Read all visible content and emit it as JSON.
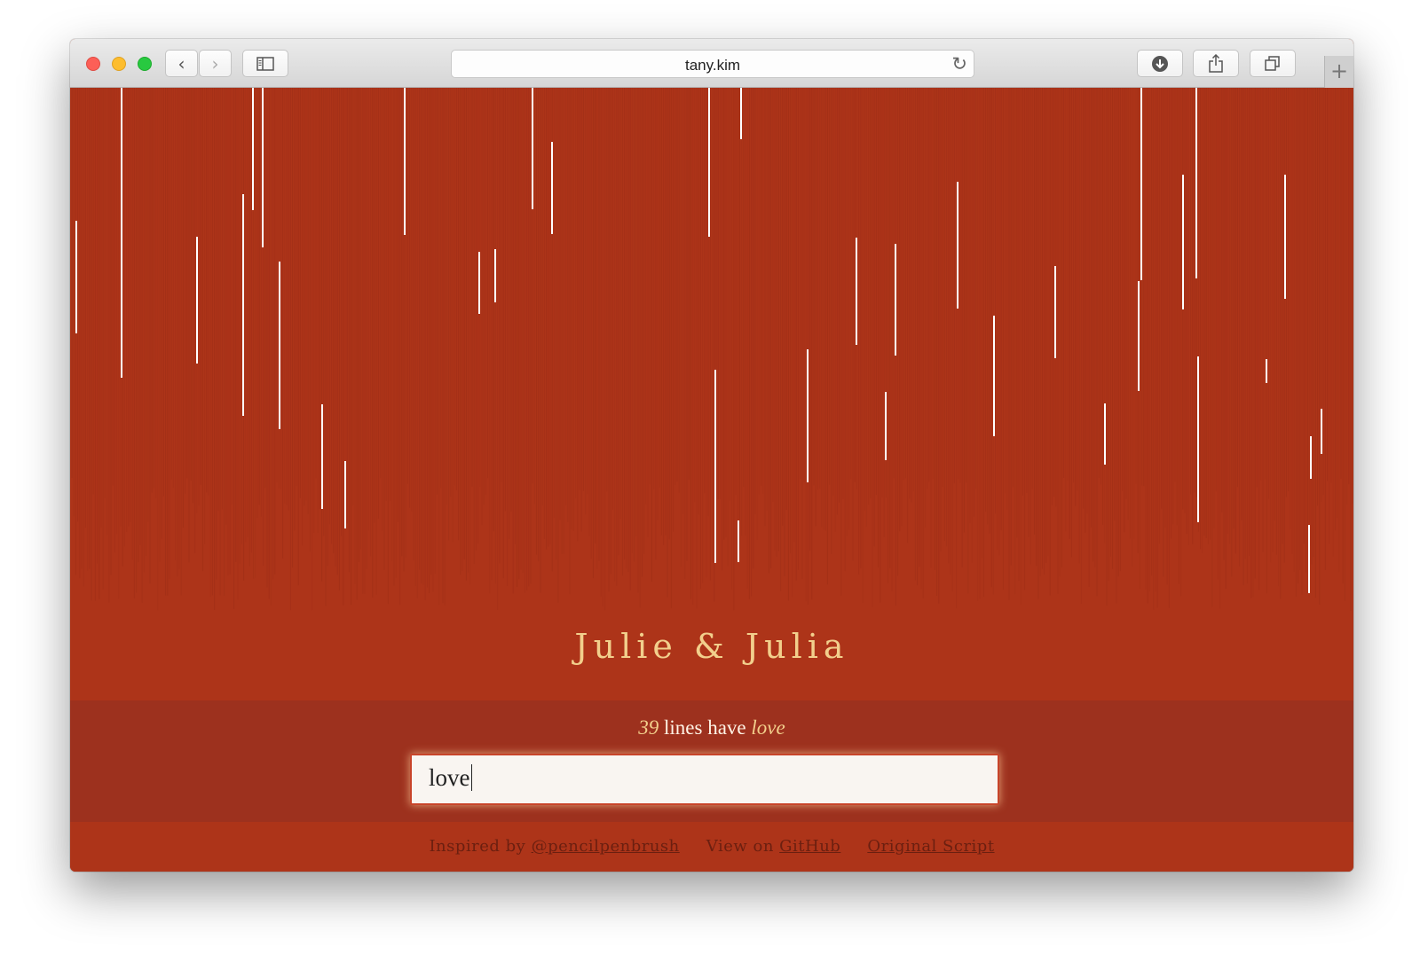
{
  "browser": {
    "url": "tany.kim",
    "back_glyph": "‹",
    "forward_glyph": "›",
    "reload_glyph": "↻",
    "new_tab_glyph": "+"
  },
  "page": {
    "title": "Julie & Julia",
    "result_count": "39",
    "result_middle": " lines have ",
    "result_term": "love",
    "search_value": "love"
  },
  "footer": {
    "inspired_prefix": "Inspired by ",
    "inspired_link": "@pencilpenbrush",
    "github_prefix": "View on ",
    "github_link": "GitHub",
    "script_link": "Original Script"
  },
  "colors": {
    "background": "#ad3419",
    "band": "#9d311e",
    "title": "#f2cf8c",
    "highlight_line": "#ffffff",
    "script_line": "#a12f17"
  },
  "icons": [
    "back-icon",
    "forward-icon",
    "sidebar-icon",
    "reload-icon",
    "download-icon",
    "share-icon",
    "tabs-icon",
    "new-tab-icon"
  ]
}
